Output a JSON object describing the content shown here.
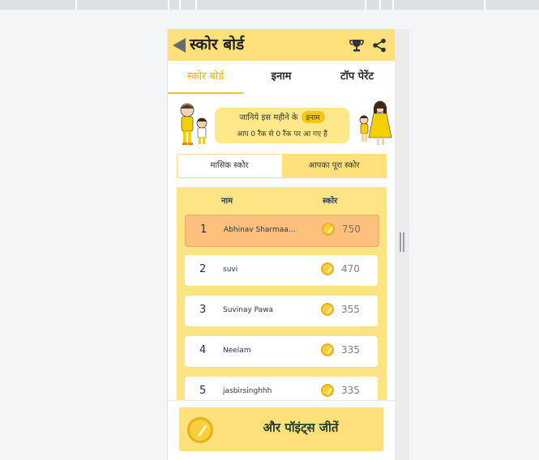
{
  "header": {
    "title": "स्कोर बोर्ड"
  },
  "tabs": [
    {
      "label": "स्कोर बोर्ड"
    },
    {
      "label": "इनाम"
    },
    {
      "label": "टॉप पेरेंट"
    }
  ],
  "banner": {
    "line1": "जानिये इस महीने के",
    "badge": "इनाम",
    "line2": "आप 0 रैंक से 0 रैंक पर आ गए हैं"
  },
  "toggle": {
    "monthly": "मासिक स्कोर",
    "total": "आपका पूरा स्कोर"
  },
  "table": {
    "col_name": "नाम",
    "col_score": "स्कोर",
    "rows": [
      {
        "rank": "1",
        "name": "Abhinav Sharmaa...",
        "score": "750"
      },
      {
        "rank": "2",
        "name": "suvi",
        "score": "470"
      },
      {
        "rank": "3",
        "name": "Suvinay Pawa",
        "score": "355"
      },
      {
        "rank": "4",
        "name": "Neelam",
        "score": "335"
      },
      {
        "rank": "5",
        "name": "jasbirsinghhh",
        "score": "335"
      }
    ]
  },
  "cta": {
    "label": "और पॉइंट्स जीतें"
  },
  "colors": {
    "accent": "#ffe07a",
    "highlight_row": "#ffc07e",
    "coin": "#f7cf3a"
  }
}
